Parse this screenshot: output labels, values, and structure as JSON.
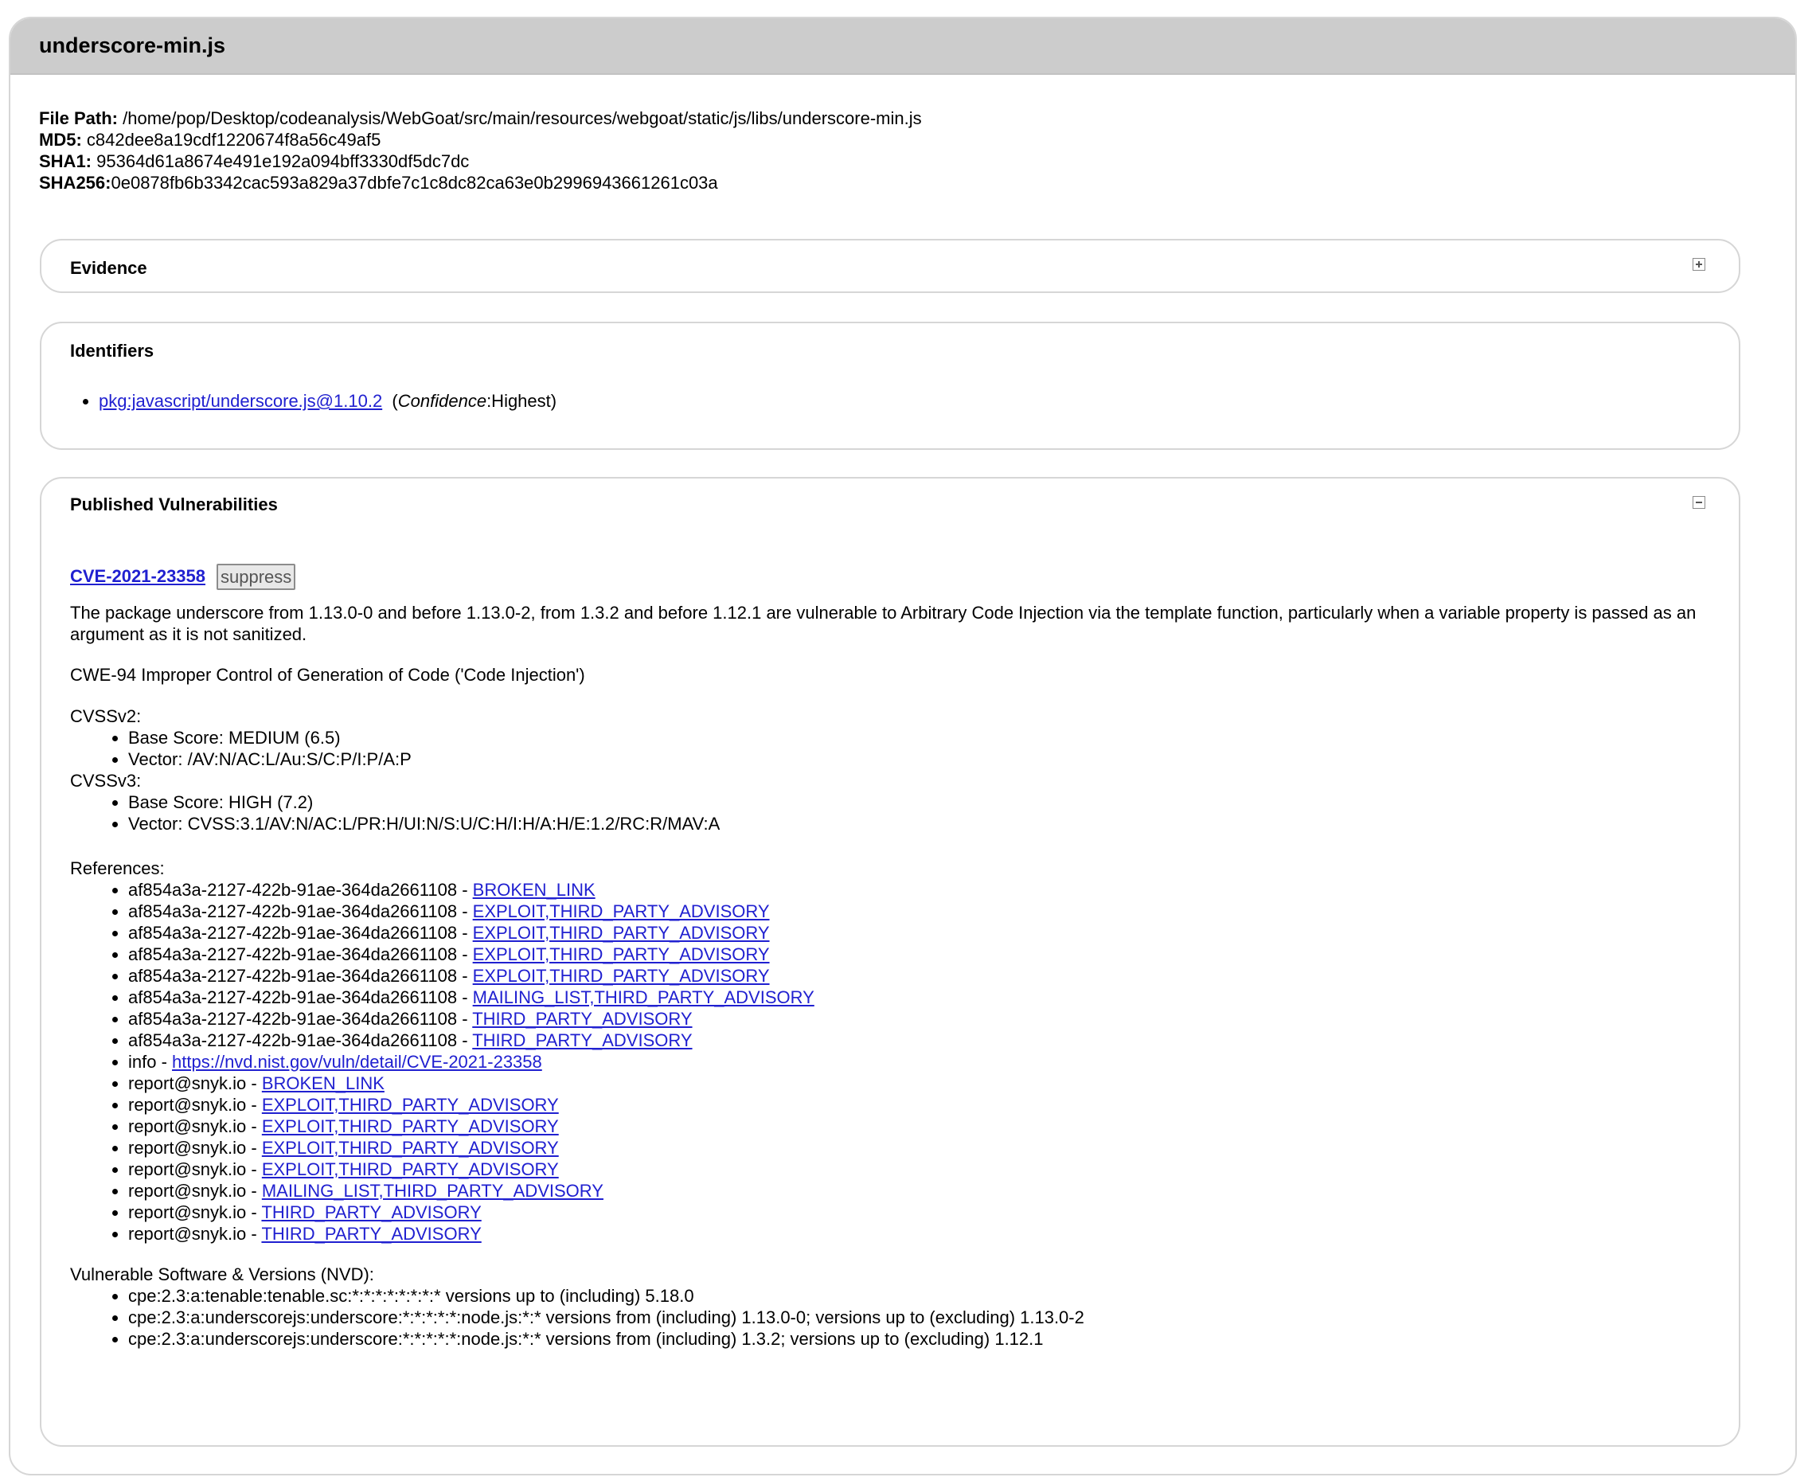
{
  "file": {
    "name": "underscore-min.js",
    "path_label": "File Path:",
    "path": " /home/pop/Desktop/codeanalysis/WebGoat/src/main/resources/webgoat/static/js/libs/underscore-min.js",
    "md5_label": "MD5:",
    "md5": " c842dee8a19cdf1220674f8a56c49af5",
    "sha1_label": "SHA1:",
    "sha1": " 95364d61a8674e491e192a094bff3330df5dc7dc",
    "sha256_label": "SHA256:",
    "sha256": "0e0878fb6b3342cac593a829a37dbfe7c1c8dc82ca63e0b2996943661261c03a"
  },
  "evidence": {
    "title": "Evidence",
    "toggle_icon": "plus-box-icon"
  },
  "identifiers": {
    "title": "Identifiers",
    "items": [
      {
        "link": "pkg:javascript/underscore.js@1.10.2",
        "confidence_open": "(",
        "confidence_label": "Confidence",
        "confidence_value": ":Highest)"
      }
    ]
  },
  "vulnerabilities": {
    "title": "Published Vulnerabilities",
    "toggle_icon": "minus-box-icon",
    "cve": "CVE-2021-23358",
    "suppress_label": "suppress",
    "description": "The package underscore from 1.13.0-0 and before 1.13.0-2, from 1.3.2 and before 1.12.1 are vulnerable to Arbitrary Code Injection via the template function, particularly when a variable property is passed as an argument as it is not sanitized.",
    "cwe": "CWE-94 Improper Control of Generation of Code ('Code Injection')",
    "cvssv2_label": "CVSSv2:",
    "cvssv2": [
      "Base Score: MEDIUM (6.5)",
      "Vector: /AV:N/AC:L/Au:S/C:P/I:P/A:P"
    ],
    "cvssv3_label": "CVSSv3:",
    "cvssv3": [
      "Base Score: HIGH (7.2)",
      "Vector: CVSS:3.1/AV:N/AC:L/PR:H/UI:N/S:U/C:H/I:H/A:H/E:1.2/RC:R/MAV:A"
    ],
    "references_label": "References:",
    "references": [
      {
        "source": "af854a3a-2127-422b-91ae-364da2661108 - ",
        "link": "BROKEN_LINK"
      },
      {
        "source": "af854a3a-2127-422b-91ae-364da2661108 - ",
        "link": "EXPLOIT,THIRD_PARTY_ADVISORY"
      },
      {
        "source": "af854a3a-2127-422b-91ae-364da2661108 - ",
        "link": "EXPLOIT,THIRD_PARTY_ADVISORY"
      },
      {
        "source": "af854a3a-2127-422b-91ae-364da2661108 - ",
        "link": "EXPLOIT,THIRD_PARTY_ADVISORY"
      },
      {
        "source": "af854a3a-2127-422b-91ae-364da2661108 - ",
        "link": "EXPLOIT,THIRD_PARTY_ADVISORY"
      },
      {
        "source": "af854a3a-2127-422b-91ae-364da2661108 - ",
        "link": "MAILING_LIST,THIRD_PARTY_ADVISORY"
      },
      {
        "source": "af854a3a-2127-422b-91ae-364da2661108 - ",
        "link": "THIRD_PARTY_ADVISORY"
      },
      {
        "source": "af854a3a-2127-422b-91ae-364da2661108 - ",
        "link": "THIRD_PARTY_ADVISORY"
      },
      {
        "source": "info - ",
        "link": "https://nvd.nist.gov/vuln/detail/CVE-2021-23358"
      },
      {
        "source": "report@snyk.io - ",
        "link": "BROKEN_LINK"
      },
      {
        "source": "report@snyk.io - ",
        "link": "EXPLOIT,THIRD_PARTY_ADVISORY"
      },
      {
        "source": "report@snyk.io - ",
        "link": "EXPLOIT,THIRD_PARTY_ADVISORY"
      },
      {
        "source": "report@snyk.io - ",
        "link": "EXPLOIT,THIRD_PARTY_ADVISORY"
      },
      {
        "source": "report@snyk.io - ",
        "link": "EXPLOIT,THIRD_PARTY_ADVISORY"
      },
      {
        "source": "report@snyk.io - ",
        "link": "MAILING_LIST,THIRD_PARTY_ADVISORY"
      },
      {
        "source": "report@snyk.io - ",
        "link": "THIRD_PARTY_ADVISORY"
      },
      {
        "source": "report@snyk.io - ",
        "link": "THIRD_PARTY_ADVISORY"
      }
    ],
    "nvd_label": "Vulnerable Software & Versions (NVD):",
    "nvd": [
      "cpe:2.3:a:tenable:tenable.sc:*:*:*:*:*:*:*:* versions up to (including) 5.18.0",
      "cpe:2.3:a:underscorejs:underscore:*:*:*:*:*:node.js:*:* versions from (including) 1.13.0-0; versions up to (excluding) 1.13.0-2",
      "cpe:2.3:a:underscorejs:underscore:*:*:*:*:*:node.js:*:* versions from (including) 1.3.2; versions up to (excluding) 1.12.1"
    ]
  },
  "colors": {
    "link": "#2020d0",
    "header_bg": "#cccccc",
    "border": "#d6d6d6"
  }
}
